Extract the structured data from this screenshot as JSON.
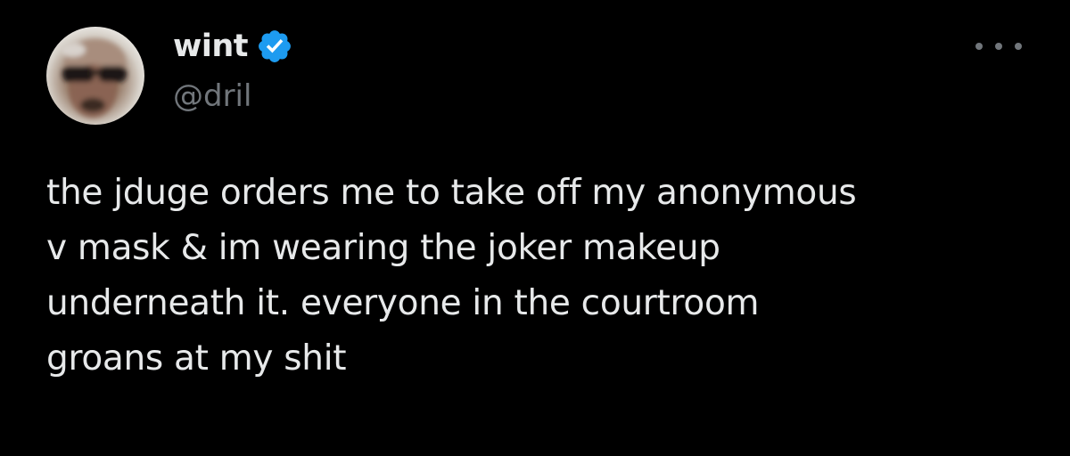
{
  "tweet": {
    "author": {
      "display_name": "wint",
      "handle": "@dril",
      "verified": true,
      "verified_icon": "verified-badge-icon"
    },
    "more_icon": "more-options-icon",
    "text_lines": [
      "the jduge orders me to take off my anonymous",
      "v mask & im wearing the joker makeup",
      "underneath it. everyone in the courtroom",
      "groans at my shit"
    ]
  },
  "colors": {
    "background": "#000000",
    "text": "#e7e9ea",
    "secondary": "#71767b",
    "verified": "#1d9bf0"
  }
}
